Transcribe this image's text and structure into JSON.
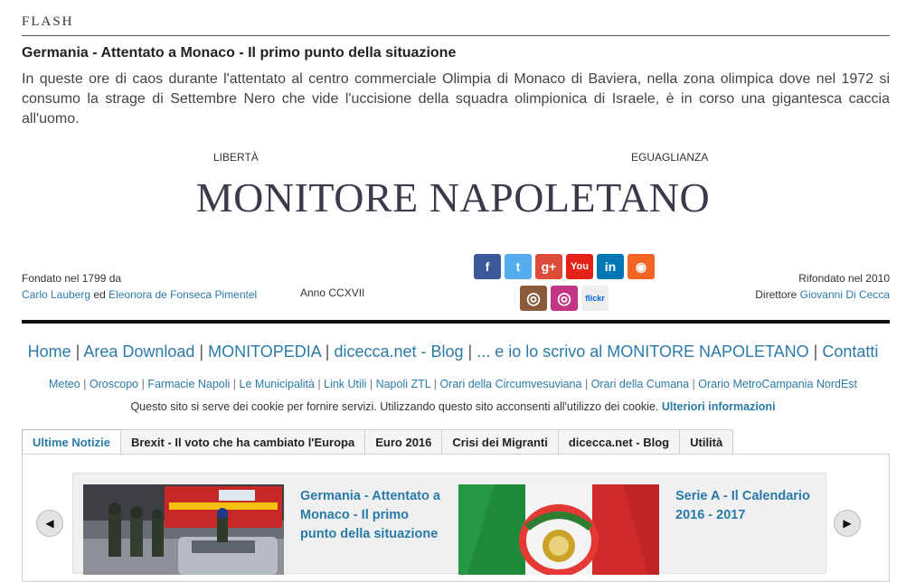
{
  "flash": {
    "label": "FLASH",
    "title": "Germania - Attentato a Monaco - Il primo punto della situazione",
    "body": "In queste ore di  caos durante l'attentato al centro commerciale Olimpia di Monaco di Baviera, nella zona olimpica dove nel 1972 si consumo la strage di Settembre Nero che vide l'uccisione della squadra olimpionica di Israele, è in corso una gigantesca caccia all'uomo."
  },
  "header": {
    "motto_left": "LIBERTÀ",
    "motto_right": "EGUAGLIANZA",
    "masthead": "MONITORE NAPOLETANO",
    "founded_line1": "Fondato nel 1799 da",
    "founder1": "Carlo Lauberg",
    "founder_sep": " ed ",
    "founder2": "Eleonora de Fonseca Pimentel",
    "anno": "Anno CCXVII",
    "refounded_line1": "Rifondato nel 2010",
    "director_label": "Direttore ",
    "director": "Giovanni Di Cecca"
  },
  "social": [
    {
      "name": "facebook-icon",
      "glyph": "f",
      "color": "#3b5998"
    },
    {
      "name": "twitter-icon",
      "glyph": "t",
      "color": "#55acee"
    },
    {
      "name": "google-plus-icon",
      "glyph": "g+",
      "color": "#dd4b39"
    },
    {
      "name": "youtube-icon",
      "glyph": "You",
      "color": "#e62117"
    },
    {
      "name": "linkedin-icon",
      "glyph": "in",
      "color": "#0077b5"
    },
    {
      "name": "rss-icon",
      "glyph": "◉",
      "color": "#f26522"
    },
    {
      "name": "camera-icon",
      "glyph": "◎",
      "color": "#8a5a3a"
    },
    {
      "name": "instagram-icon",
      "glyph": "◎",
      "color": "#c13584"
    },
    {
      "name": "flickr-icon",
      "glyph": "flickr",
      "color": "#eeeeee"
    }
  ],
  "nav": {
    "main": [
      "Home",
      "Area Download",
      "MONITOPEDIA",
      "dicecca.net - Blog",
      "... e io lo scrivo al MONITORE NAPOLETANO",
      "Contatti"
    ],
    "sub": [
      "Meteo",
      "Oroscopo",
      "Farmacie Napoli",
      "Le Municipalità",
      "Link Utili",
      "Napoli ZTL",
      "Orari della Circumvesuviana",
      "Orari della Cumana",
      "Orario MetroCampania NordEst"
    ]
  },
  "cookie": {
    "text": "Questo sito si serve dei cookie per fornire servizi. Utilizzando questo sito acconsenti all'utilizzo dei cookie. ",
    "link": "Ulteriori informazioni"
  },
  "tabs": [
    "Ultime Notizie",
    "Brexit - Il voto che ha cambiato l'Europa",
    "Euro 2016",
    "Crisi dei Migranti",
    "dicecca.net - Blog",
    "Utilità"
  ],
  "carousel": {
    "prev": "◀",
    "next": "▶",
    "slides": [
      {
        "title": "Germania - Attentato a Monaco - Il primo punto della situazione"
      },
      {
        "title": "Serie A - Il Calendario 2016 - 2017"
      }
    ]
  }
}
